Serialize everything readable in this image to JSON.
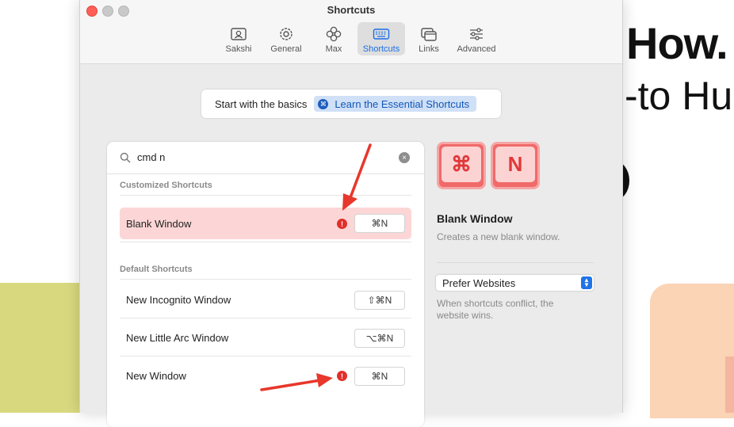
{
  "background_page": {
    "headline": "How.",
    "subheadline": "-to Hu"
  },
  "window": {
    "title": "Shortcuts",
    "tabs": [
      {
        "label": "Sakshi",
        "icon": "profile-card-icon"
      },
      {
        "label": "General",
        "icon": "gear-icon"
      },
      {
        "label": "Max",
        "icon": "flower-icon"
      },
      {
        "label": "Shortcuts",
        "icon": "keyboard-icon",
        "active": true
      },
      {
        "label": "Links",
        "icon": "links-icon"
      },
      {
        "label": "Advanced",
        "icon": "sliders-icon"
      }
    ]
  },
  "basics": {
    "text": "Start with the basics",
    "button_label": "Learn the Essential Shortcuts",
    "button_icon": "⌘"
  },
  "search": {
    "value": "cmd n",
    "clear_icon": "×"
  },
  "customized": {
    "heading": "Customized Shortcuts",
    "rows": [
      {
        "label": "Blank Window",
        "shortcut": "⌘N",
        "conflict": true
      }
    ]
  },
  "defaults": {
    "heading": "Default Shortcuts",
    "rows": [
      {
        "label": "New Incognito Window",
        "shortcut": "⇧⌘N"
      },
      {
        "label": "New Little Arc Window",
        "shortcut": "⌥⌘N"
      },
      {
        "label": "New Window",
        "shortcut": "⌘N",
        "conflict": true
      }
    ]
  },
  "detail": {
    "keys": [
      "⌘",
      "N"
    ],
    "title": "Blank Window",
    "description": "Creates a new blank window.",
    "select_value": "Prefer Websites",
    "conflict_note": "When shortcuts conflict, the website wins."
  },
  "warning_glyph": "!",
  "colors": {
    "accent": "#1a6fe8",
    "highlight_row": "#fcd6d6",
    "warning": "#e0302b",
    "annotation_arrow": "#e8372b"
  }
}
